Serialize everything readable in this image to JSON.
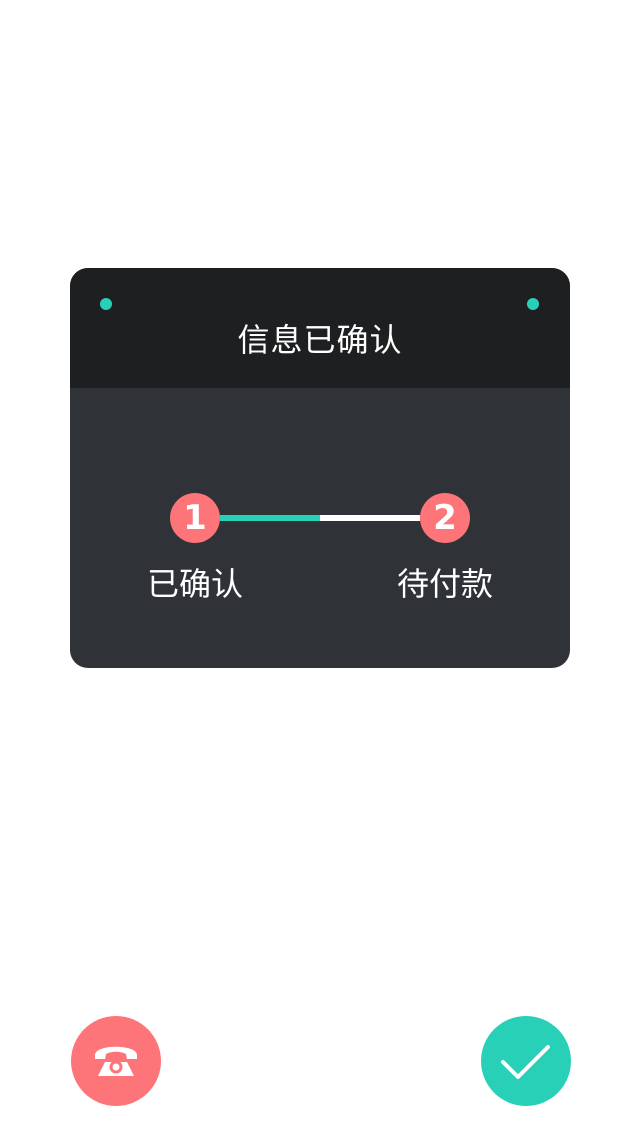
{
  "colors": {
    "accent": "#27d0b7",
    "pink": "#fd7479",
    "card_body": "#2f3237",
    "card_header": "#1e1f20",
    "white": "#ffffff"
  },
  "card": {
    "title": "信息已确认"
  },
  "progress": {
    "steps": [
      {
        "number": "1",
        "label": "已确认",
        "status": "done"
      },
      {
        "number": "2",
        "label": "待付款",
        "status": "pending"
      }
    ],
    "segment_complete": 0.5
  },
  "actions": {
    "call_icon": "phone-icon",
    "confirm_icon": "checkmark-icon"
  }
}
